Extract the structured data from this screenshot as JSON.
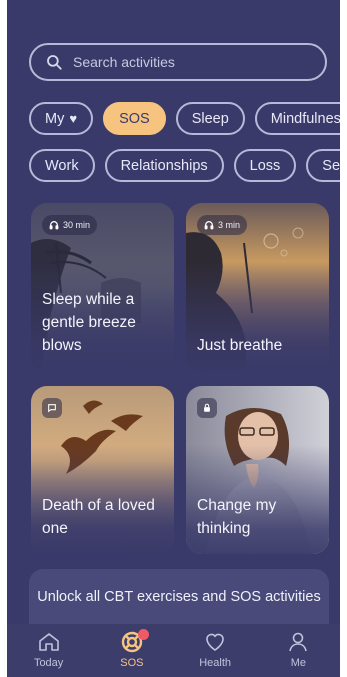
{
  "search": {
    "placeholder": "Search activities"
  },
  "chips_row1": [
    "My",
    "SOS",
    "Sleep",
    "Mindfulness"
  ],
  "chips_row2": [
    "Work",
    "Relationships",
    "Loss",
    "Self"
  ],
  "cards": [
    {
      "title": "Sleep while a gentle breeze blows",
      "badge": "30 min",
      "badge_icon": "headphones-icon"
    },
    {
      "title": "Just breathe",
      "badge": "3 min",
      "badge_icon": "headphones-icon"
    },
    {
      "title": "Death of a loved one",
      "badge_icon": "chat-icon"
    },
    {
      "title": "Change my thinking",
      "badge_icon": "lock-icon"
    }
  ],
  "unlock": {
    "text": "Unlock all CBT exercises and SOS activities"
  },
  "tabs": [
    {
      "label": "Today",
      "icon": "home-icon"
    },
    {
      "label": "SOS",
      "icon": "lifebuoy-icon"
    },
    {
      "label": "Health",
      "icon": "heart-icon"
    },
    {
      "label": "Me",
      "icon": "person-icon"
    }
  ],
  "colors": {
    "background": "#3a3a6a",
    "accent": "#f6c47e",
    "notification": "#ef5a64"
  }
}
